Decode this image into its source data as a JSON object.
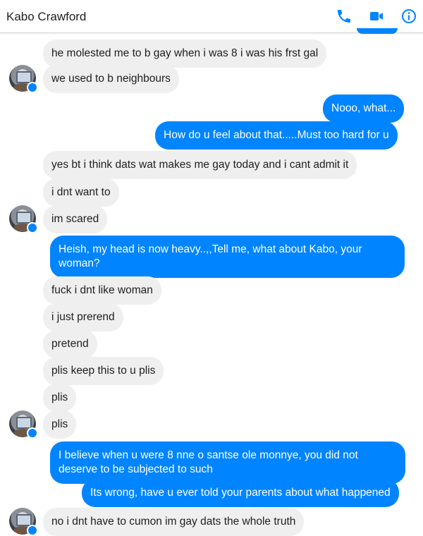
{
  "header": {
    "contact_name": "Kabo Crawford",
    "icons": [
      "phone-icon",
      "video-camera-icon",
      "info-icon"
    ],
    "accent_color": "#0084ff"
  },
  "messages": [
    {
      "sender": "contact",
      "text": "he molested me to b gay when i was 8 i was his frst gal"
    },
    {
      "sender": "contact",
      "text": "we used to b neighbours"
    },
    {
      "sender": "me",
      "text": "Nooo, what..."
    },
    {
      "sender": "me",
      "text": "How do u feel about that.....Must too hard for u"
    },
    {
      "sender": "contact",
      "text": "yes bt i think dats wat makes me gay today and i cant admit it"
    },
    {
      "sender": "contact",
      "text": "i dnt want to"
    },
    {
      "sender": "contact",
      "text": "im scared"
    },
    {
      "sender": "me",
      "text": "Heish, my head is now heavy..,,Tell me, what about Kabo, your woman?"
    },
    {
      "sender": "contact",
      "text": "fuck i dnt like woman"
    },
    {
      "sender": "contact",
      "text": "i just prerend"
    },
    {
      "sender": "contact",
      "text": "pretend"
    },
    {
      "sender": "contact",
      "text": "plis keep this to u plis"
    },
    {
      "sender": "contact",
      "text": "plis"
    },
    {
      "sender": "contact",
      "text": "plis"
    },
    {
      "sender": "me",
      "text": "I believe when u were 8 nne o santse ole monnye, you did not deserve to be subjected to such"
    },
    {
      "sender": "me",
      "text": "Its wrong, have u ever told your parents about what happened"
    },
    {
      "sender": "contact",
      "text": "no i dnt have to cumon im gay dats the whole truth"
    }
  ],
  "colors": {
    "incoming_bubble": "#efefef",
    "outgoing_bubble": "#0084ff",
    "incoming_text": "#1c1e21",
    "outgoing_text": "#ffffff"
  }
}
